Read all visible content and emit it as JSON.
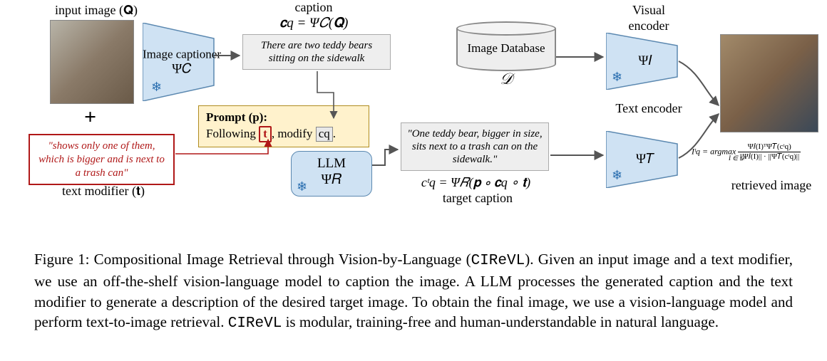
{
  "labels": {
    "input_image": "input image (𝐐)",
    "text_modifier": "text modifier (𝐭)",
    "caption_heading": "caption",
    "caption_formula": "𝐜q = Ψ𝐶(𝐐)",
    "target_caption_formula": "cᵗq = Ψ𝑅(𝐩 ∘ 𝐜q ∘ 𝐭)",
    "target_caption_label": "target caption",
    "retrieved_image": "retrieved image"
  },
  "modules": {
    "image_captioner": {
      "title": "Image captioner",
      "symbol": "Ψ𝐶"
    },
    "llm": {
      "title": "LLM",
      "symbol": "Ψ𝑅"
    },
    "visual_encoder": {
      "title": "Visual encoder",
      "symbol": "Ψ𝐼"
    },
    "text_encoder": {
      "title": "Text encoder",
      "symbol": "Ψ𝑇"
    },
    "image_database": {
      "title": "Image Database",
      "symbol": "𝒟"
    }
  },
  "texts": {
    "generated_caption": "There are two teddy bears sitting on the sidewalk",
    "text_modifier": "\"shows only one of them, which is bigger and is next to a trash can\"",
    "target_caption": "\"One teddy bear, bigger in size, sits next to a trash can on the sidewalk.\"",
    "prompt_label": "Prompt (p):",
    "prompt_body_a": "Following",
    "prompt_body_b": "modify",
    "prompt_t": "t",
    "prompt_c": "cq",
    "prompt_period": "."
  },
  "equation": {
    "lhs": "Iᵗq = argmax",
    "sub": "I ∈ 𝒟",
    "num": "Ψ𝐼(I)ᵀΨ𝑇(cᵗq)",
    "den": "||Ψ𝐼(I)|| · ||Ψ𝑇(cᵗq)||"
  },
  "figure_caption": {
    "lead": "Figure 1: Compositional Image Retrieval through Vision-by-Language (",
    "acronym": "CIReVL",
    "body1": "). Given an input image and a text modifier, we use an off-the-shelf vision-language model to caption the image. A LLM processes the generated caption and the text modifier to generate a description of the desired target image. To obtain the final image, we use a vision-language model and perform text-to-image retrieval. ",
    "body2": " is modular, training-free and human-understandable in natural language."
  },
  "chart_data": {
    "type": "diagram",
    "nodes": [
      {
        "id": "Q",
        "label": "input image (Q)",
        "kind": "image"
      },
      {
        "id": "PsiC",
        "label": "Image captioner Ψ_C",
        "kind": "module-frozen"
      },
      {
        "id": "cq",
        "label": "caption c_q = Ψ_C(Q)",
        "kind": "text",
        "example": "There are two teddy bears sitting on the sidewalk"
      },
      {
        "id": "t",
        "label": "text modifier (t)",
        "kind": "text",
        "example": "shows only one of them, which is bigger and is next to a trash can"
      },
      {
        "id": "p",
        "label": "Prompt (p): Following t, modify c_q.",
        "kind": "prompt"
      },
      {
        "id": "PsiR",
        "label": "LLM Ψ_R",
        "kind": "module-frozen"
      },
      {
        "id": "cqt",
        "label": "target caption c_q^t = Ψ_R(p ∘ c_q ∘ t)",
        "kind": "text",
        "example": "One teddy bear, bigger in size, sits next to a trash can on the sidewalk."
      },
      {
        "id": "D",
        "label": "Image Database 𝒟",
        "kind": "database"
      },
      {
        "id": "PsiI",
        "label": "Visual encoder Ψ_I",
        "kind": "module-frozen"
      },
      {
        "id": "PsiT",
        "label": "Text encoder Ψ_T",
        "kind": "module-frozen"
      },
      {
        "id": "Iqt",
        "label": "retrieved image I_q^t = argmax_{I∈𝒟} Ψ_I(I)ᵀΨ_T(c_q^t) / (||Ψ_I(I)||·||Ψ_T(c_q^t)||)",
        "kind": "image"
      }
    ],
    "edges": [
      {
        "from": "Q",
        "to": "PsiC"
      },
      {
        "from": "PsiC",
        "to": "cq"
      },
      {
        "from": "Q",
        "to": "p",
        "via": "plus"
      },
      {
        "from": "t",
        "to": "p"
      },
      {
        "from": "cq",
        "to": "p"
      },
      {
        "from": "p",
        "to": "PsiR"
      },
      {
        "from": "PsiR",
        "to": "cqt"
      },
      {
        "from": "D",
        "to": "PsiI"
      },
      {
        "from": "cqt",
        "to": "PsiT"
      },
      {
        "from": "PsiI",
        "to": "Iqt"
      },
      {
        "from": "PsiT",
        "to": "Iqt"
      }
    ]
  }
}
